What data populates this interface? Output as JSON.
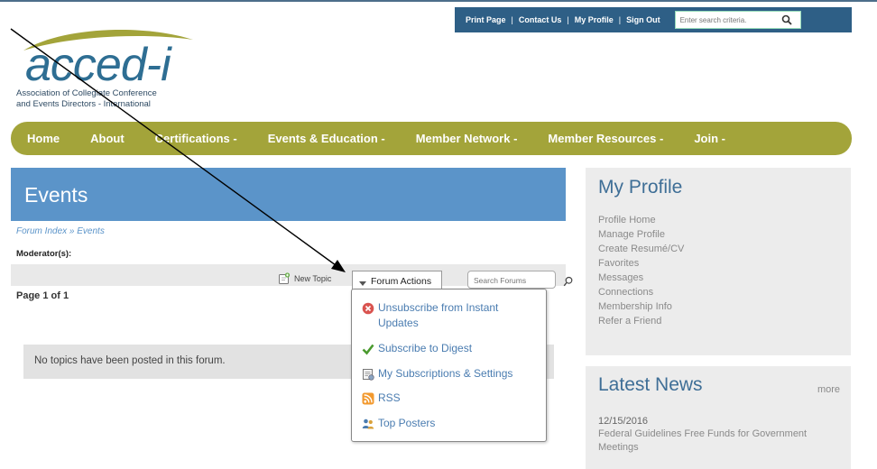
{
  "header": {
    "util_links": [
      "Print Page",
      "Contact Us",
      "My Profile",
      "Sign Out"
    ],
    "separator": "|",
    "search_placeholder": "Enter search criteria.",
    "search_icon": "search-icon"
  },
  "logo": {
    "text": "acced-i",
    "subtitle_line1": "Association of Collegiate Conference",
    "subtitle_line2": "and Events Directors - International",
    "colors": {
      "text": "#2e6e93",
      "swoosh": "#a3a43a"
    }
  },
  "nav": {
    "items": [
      "Home",
      "About",
      "Certifications -",
      "Events & Education -",
      "Member Network -",
      "Member Resources -",
      "Join -"
    ],
    "color": "#a3a43a"
  },
  "main": {
    "title": "Events",
    "breadcrumb_index": "Forum Index",
    "breadcrumb_sep": " » ",
    "breadcrumb_current": "Events",
    "moderator_label": "Moderator(s):",
    "new_topic_label": "New Topic",
    "forum_actions_label": "Forum Actions",
    "search_forums_placeholder": "Search Forums",
    "page_label": "Page 1 of 1",
    "empty_message": "No topics have been posted in this forum."
  },
  "dropdown": {
    "items": [
      {
        "label": "Unsubscribe from Instant Updates",
        "icon": "unsubscribe-icon"
      },
      {
        "label": "Subscribe to Digest",
        "icon": "checkmark-icon"
      },
      {
        "label": "My Subscriptions & Settings",
        "icon": "settings-icon"
      },
      {
        "label": "RSS",
        "icon": "rss-icon"
      },
      {
        "label": "Top Posters",
        "icon": "users-icon"
      }
    ]
  },
  "sidebar": {
    "profile_title": "My Profile",
    "profile_links": [
      "Profile Home",
      "Manage Profile",
      "Create Resumé/CV",
      "Favorites",
      "Messages",
      "Connections",
      "Membership Info",
      "Refer a Friend"
    ],
    "news_title": "Latest News",
    "news_more": "more",
    "news_date": "12/15/2016",
    "news_headline": "Federal Guidelines Free Funds for Government Meetings"
  }
}
